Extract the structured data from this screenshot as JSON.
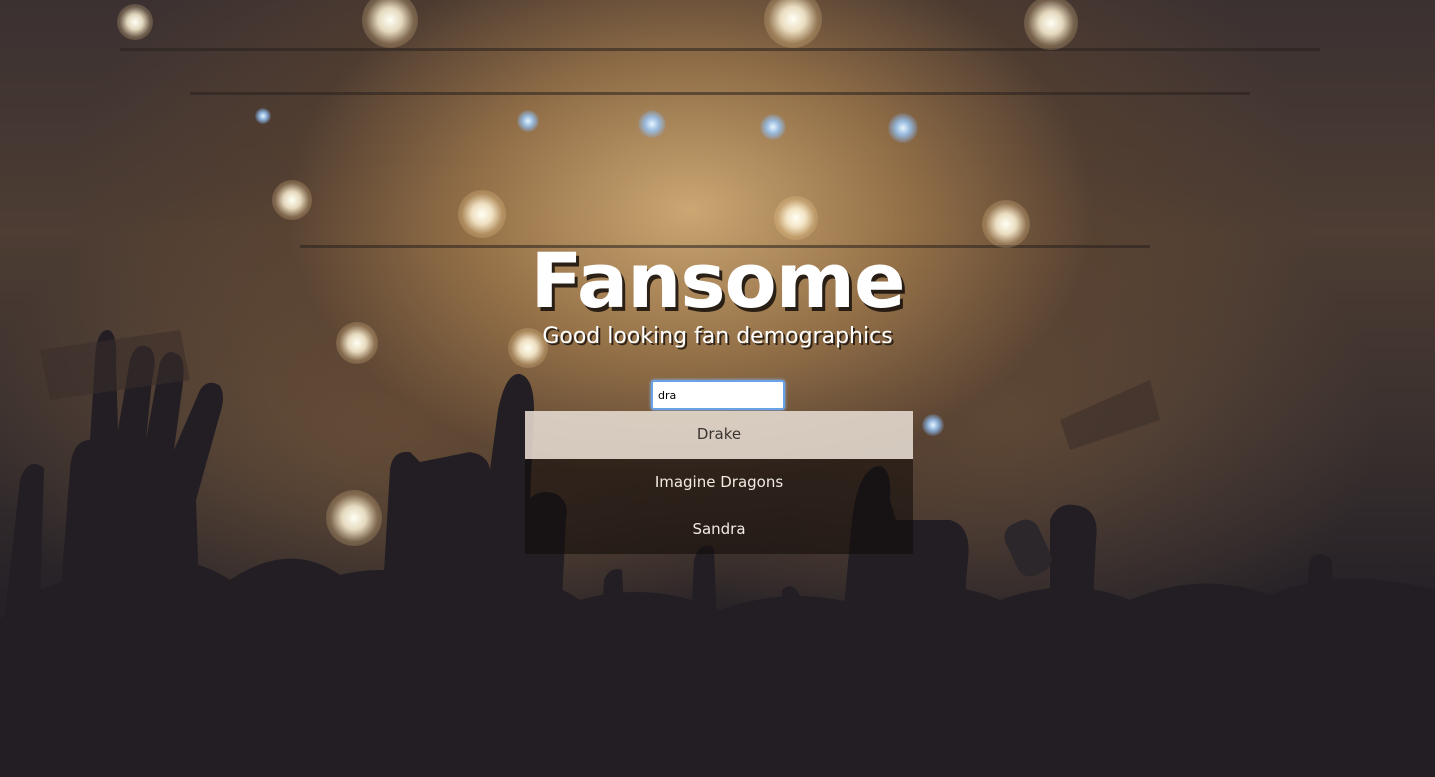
{
  "app": {
    "title": "Fansome",
    "tagline": "Good looking fan demographics"
  },
  "search": {
    "value": "dra",
    "placeholder": ""
  },
  "suggestions": [
    {
      "label": "Drake",
      "active": true
    },
    {
      "label": "Imagine Dragons",
      "active": false
    },
    {
      "label": "Sandra",
      "active": false
    }
  ]
}
